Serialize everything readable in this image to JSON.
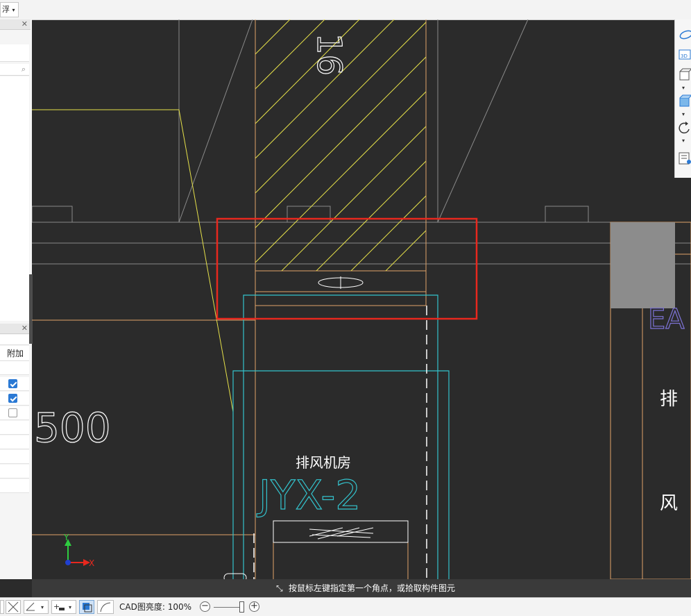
{
  "topbar": {
    "dropdown_label": "浮"
  },
  "left_panel": {
    "grid_header": "附加",
    "checkboxes": [
      true,
      true,
      false
    ]
  },
  "cad": {
    "label_500": "500",
    "label_jyx2": "JYX-2",
    "label_room": "排风机房",
    "label_16": "16",
    "label_ea": "EA",
    "label_pai": "排",
    "label_feng": "风",
    "axis_y": "Y",
    "axis_x": "X"
  },
  "status": {
    "message": "按鼠标左键指定第一个角点，或拾取构件图元"
  },
  "bottombar": {
    "brightness_label": "CAD图亮度:",
    "brightness_value": "100%"
  },
  "colors": {
    "cad_bg": "#2b2b2b",
    "yellow": "#e6e14a",
    "orange": "#e0a36a",
    "cyan": "#33c2cc",
    "red_selection": "#e8281e",
    "purple_text": "#7d73d6"
  }
}
